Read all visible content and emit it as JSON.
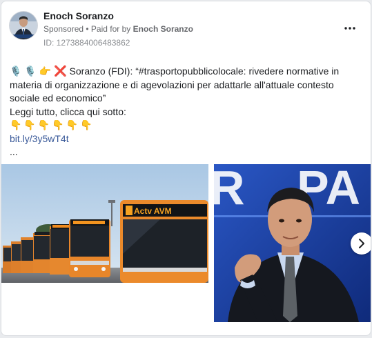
{
  "post": {
    "author": "Enoch Soranzo",
    "sponsored_label": "Sponsored",
    "separator": " • ",
    "paid_for_prefix": "Paid for by ",
    "paid_for_name": "Enoch Soranzo",
    "ad_id": "ID: 1273884006483862",
    "more_icon": "more-options-icon",
    "text": {
      "lead_emojis": "🎙️ 🎙️ 👉",
      "x_icon": "❌",
      "line1": " Soranzo (FDI): “#trasportopubblicolocale: rivedere normative in materia di organizzazione e di agevolazioni per adattarle all'attuale contesto sociale ed economico”",
      "line2": "Leggi tutto, clicca qui sotto:",
      "pointing_emojis": "👇👇👇👇👇👇",
      "link": "bit.ly/3y5wT4t",
      "ellipsis": "..."
    },
    "images": [
      {
        "name": "buses-photo",
        "sign_text": "Actv AVM"
      },
      {
        "name": "speaker-photo"
      }
    ],
    "carousel_next_icon": "chevron-right-icon"
  },
  "colors": {
    "text_primary": "#1c1e21",
    "text_secondary": "#65676b",
    "link": "#385898",
    "bus_orange": "#e8862a",
    "background": "#ffffff"
  }
}
